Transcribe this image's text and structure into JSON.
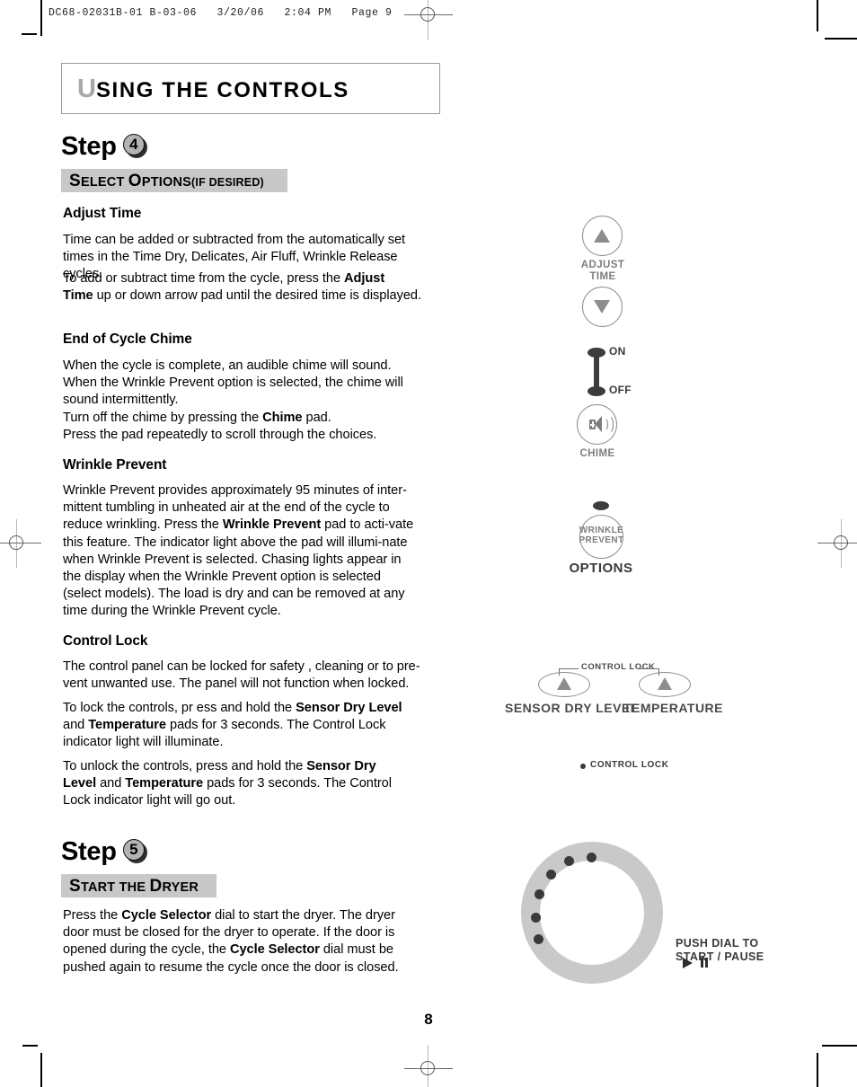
{
  "film_header": "DC68-02031B-01 B-03-06   3/20/06   2:04 PM   Page 9",
  "chapter": {
    "drop_cap": "U",
    "rest": "SING  THE  CONTROLS"
  },
  "steps": [
    {
      "label": "Step",
      "number": "4",
      "band": {
        "cap1": "S",
        "small1": "ELECT ",
        "cap2": "O",
        "small2": "PTIONS",
        "paren": "(IF DESIRED)"
      },
      "sections": [
        {
          "heading": "Adjust Time",
          "paragraphs": [
            "Time can be added or subtracted from the automatically set times in the Time Dry, Delicates, Air Fluff, Wrinkle Release cycles.",
            "To add or subtract time from the cycle, press the Adjust Time up or down arrow pad until the desired time is displayed."
          ]
        },
        {
          "heading": "End of Cycle Chime",
          "paragraphs": [
            "When the cycle is complete, an audible chime will sound. When the Wrinkle Prevent option is selected, the chime will sound intermittently. Turn off the chime by pressing the Chime pad. Press the pad repeatedly to scroll through the choices."
          ]
        },
        {
          "heading": "Wrinkle Prevent",
          "paragraphs": [
            "Wrinkle Prevent provides approximately 95 minutes of intermittent tumbling in unheated air at the end of the cycle to reduce wrinkling. Press the Wrinkle Prevent pad to activate this feature. The indicator light above the pad will illuminate when Wrinkle Prevent is selected. Chasing lights appear in the display when the Wrinkle Prevent option is selected (select models). The load is dry and can be removed at any time during the Wrinkle Prevent cycle."
          ]
        },
        {
          "heading": "Control Lock",
          "paragraphs": [
            "The control panel can be locked for safety , cleaning or to prevent unwanted use. The panel will not function when locked.",
            "To lock the controls,  pr ess and hold the Sensor Dry Level and Temperature pads for 3 seconds. The Control Lock indicator light will illuminate.",
            "To unlock the controls,  press and hold the Sensor Dry Level and Temperature pads for 3 seconds. The Control Lock indicator light will go out."
          ]
        }
      ]
    },
    {
      "label": "Step",
      "number": "5",
      "band": {
        "cap1": "S",
        "small1": "TART THE ",
        "cap2": "D",
        "small2": "RYER",
        "paren": ""
      },
      "sections": [
        {
          "heading": "",
          "paragraphs": [
            "Press the Cycle Selector dial to start the dryer.  The dryer door must be closed for the dryer to operate. If the door is opened during the cycle, the Cycle Selector dial must be pushed again to resume the cycle once the door is closed."
          ]
        }
      ]
    }
  ],
  "body_text": {
    "adjust_time_p1_a": "Time can be added or subtracted from the automatically set",
    "adjust_time_p1_b": "times in the Time Dry, Delicates, Air Fluff, Wrinkle Release cycles.",
    "adjust_time_p2_pre": "To add or subtract time from the cycle, press the ",
    "adjust_time_p2_b1": "Adjust",
    "adjust_time_p2_b2": "Time",
    "adjust_time_p2_post": " up or down arrow pad until the desired time is displayed.",
    "chime_l1": "When the cycle is complete, an audible chime will sound.",
    "chime_l2": "When the Wrinkle Prevent option is selected, the chime will",
    "chime_l3": "sound intermittently.",
    "chime_l4_pre": "Turn off the chime by pressing the ",
    "chime_l4_b": "Chime",
    "chime_l4_post": " pad.",
    "chime_l5": "Press the pad repeatedly to scroll through the choices.",
    "wp_pre": "Wrinkle Prevent provides approximately 95 minutes of inter-mittent tumbling in unheated air at the end of the cycle to reduce wrinkling. Press the ",
    "wp_b": "Wrinkle Prevent",
    "wp_post": " pad to acti-vate this feature. The indicator light above the pad will illumi-nate when Wrinkle Prevent is selected. Chasing lights appear in the display when the Wrinkle Prevent option is selected (select models). The load is dry and can be removed at any time during the Wrinkle Prevent cycle.",
    "cl_p1": "The control panel can be locked for safety , cleaning or to pre-vent unwanted use. The panel will not function when locked.",
    "cl_p2_pre": "To lock the controls,  pr ess and hold the ",
    "cl_p2_b1": "Sensor Dry Level",
    "cl_p2_mid": " and ",
    "cl_p2_b2": "Temperature",
    "cl_p2_post": " pads for 3 seconds. The Control Lock indicator light will illuminate.",
    "cl_p3_pre": "To unlock the controls,  press and hold the ",
    "cl_p3_b1": "Sensor Dry Level",
    "cl_p3_mid": " and ",
    "cl_p3_b2": "Temperature",
    "cl_p3_post": " pads for 3 seconds. The Control Lock indicator light will go out.",
    "step5_pre": "Press the ",
    "step5_b1": "Cycle Selector",
    "step5_mid": " dial to start the dryer.  The dryer door must be closed for the dryer to operate. If the door is opened during the cycle, the ",
    "step5_b2": "Cycle Selector",
    "step5_post": " dial must be pushed again to resume the cycle once the door is closed."
  },
  "illustrations": {
    "adjust_time": {
      "line1": "ADJUST",
      "line2": "TIME"
    },
    "chime": {
      "on": "ON",
      "off": "OFF",
      "label": "CHIME"
    },
    "options": {
      "pad_l1": "WRINKLE",
      "pad_l2": "PREVENT",
      "label": "OPTIONS"
    },
    "control_lock": {
      "bracket": "CONTROL LOCK",
      "left_pad": "SENSOR DRY LEVEL",
      "right_pad": "TEMPERATURE",
      "indicator": "CONTROL LOCK"
    },
    "dial": {
      "line1": "PUSH DIAL TO",
      "line2": "START / PAUSE",
      "dot_count": 6
    }
  },
  "page_number": "8",
  "colors": {
    "band_gray": "#c8c8c8",
    "illus_gray": "#8d8d8d",
    "dial_gray": "#c9c9c9",
    "dark": "#3a3a3a"
  }
}
